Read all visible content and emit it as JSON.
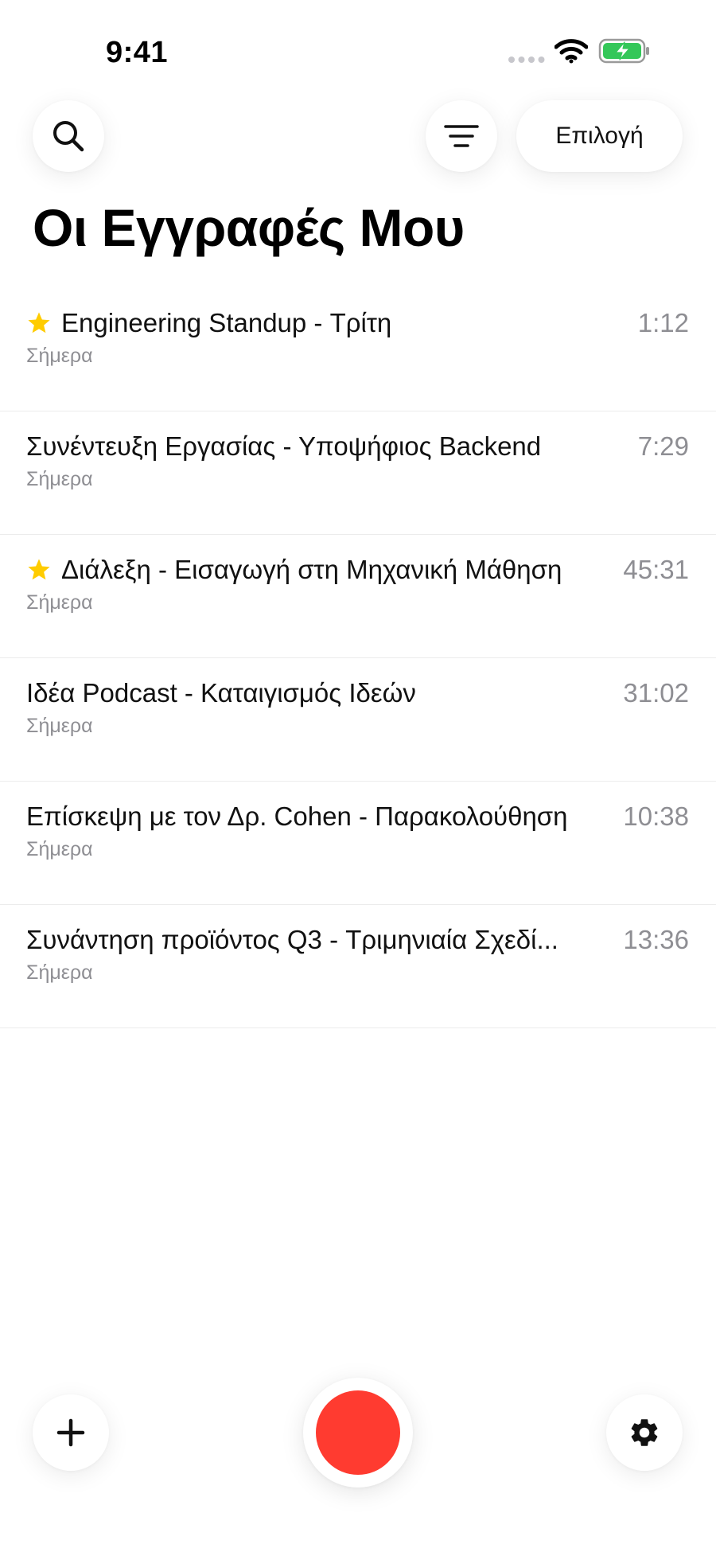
{
  "status_bar": {
    "time": "9:41",
    "icons": [
      "signal-dots-icon",
      "wifi-icon",
      "battery-charging-icon"
    ],
    "battery_color": "#34c759"
  },
  "header": {
    "search_icon": "search-icon",
    "filter_icon": "filter-icon",
    "select_label": "Επιλογή",
    "title": "Οι Εγγραφές Μου"
  },
  "recordings": [
    {
      "title": "Engineering Standup - Τρίτη",
      "date": "Σήμερα",
      "duration": "1:12",
      "starred": true
    },
    {
      "title": "Συνέντευξη Εργασίας - Υποψήφιος Backend",
      "date": "Σήμερα",
      "duration": "7:29",
      "starred": false
    },
    {
      "title": "Διάλεξη - Εισαγωγή στη Μηχανική Μάθηση",
      "date": "Σήμερα",
      "duration": "45:31",
      "starred": true
    },
    {
      "title": "Ιδέα Podcast - Καταιγισμός Ιδεών",
      "date": "Σήμερα",
      "duration": "31:02",
      "starred": false
    },
    {
      "title": "Επίσκεψη με τον Δρ. Cohen - Παρακολούθηση",
      "date": "Σήμερα",
      "duration": "10:38",
      "starred": false
    },
    {
      "title": "Συνάντηση προϊόντος Q3 - Τριμηνιαία Σχεδί...",
      "date": "Σήμερα",
      "duration": "13:36",
      "starred": false
    }
  ],
  "bottom_bar": {
    "add_icon": "plus-icon",
    "record_icon": "record-icon",
    "settings_icon": "gear-icon",
    "record_color": "#ff3b30",
    "star_color": "#ffcc00"
  }
}
